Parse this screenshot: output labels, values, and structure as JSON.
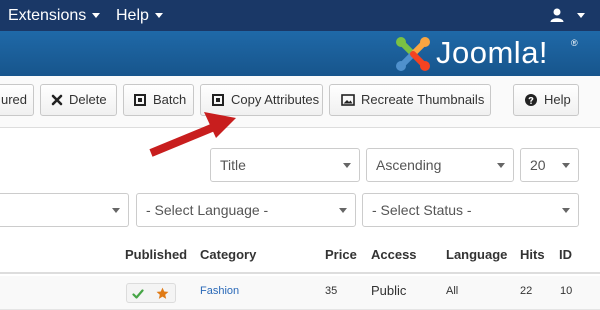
{
  "topnav": {
    "menus": [
      {
        "label": "Extensions"
      },
      {
        "label": "Help"
      }
    ],
    "user_icon": "user-icon"
  },
  "header": {
    "logo_text": "Joomla!",
    "logo_reg": "®",
    "colors": {
      "nav": "#1a3867",
      "header": "#1f69a8"
    }
  },
  "toolbar": {
    "featured_label": "ured",
    "delete_label": "Delete",
    "batch_label": "Batch",
    "copy_label": "Copy Attributes",
    "thumbs_label": "Recreate Thumbnails",
    "help_label": "Help"
  },
  "annotation": {
    "arrow_color": "#c81e1e",
    "points_to": "Copy Attributes"
  },
  "filters": {
    "sort_field": "Title",
    "sort_order": "Ascending",
    "limit": "20",
    "category": "",
    "language": "- Select Language -",
    "status": "- Select Status -"
  },
  "table": {
    "columns": [
      "Published",
      "Category",
      "Price",
      "Access",
      "Language",
      "Hits",
      "ID"
    ],
    "rows": [
      {
        "published": true,
        "featured": true,
        "category": "Fashion",
        "price": "35",
        "access": "Public",
        "language": "All",
        "hits": "22",
        "id": "10"
      }
    ]
  }
}
